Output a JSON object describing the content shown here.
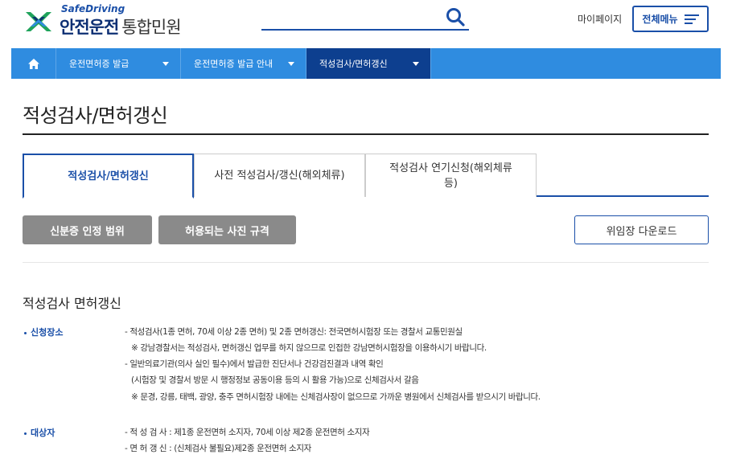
{
  "header": {
    "logo_en": "SafeDriving",
    "logo_ko": "안전운전",
    "logo_sub": "통합민원",
    "search_placeholder": "",
    "mypage": "마이페이지",
    "allmenu": "전체메뉴"
  },
  "nav": {
    "items": [
      {
        "label": "운전면허증 발급"
      },
      {
        "label": "운전면허증 발급 안내"
      },
      {
        "label": "적성검사/면허갱신"
      }
    ]
  },
  "page": {
    "title": "적성검사/면허갱신"
  },
  "tabs": [
    {
      "label": "적성검사/면허갱신"
    },
    {
      "label": "사전 적성검사/갱신(해외체류)"
    },
    {
      "label": "적성검사 연기신청(해외체류 등)"
    }
  ],
  "buttons": {
    "id_scope": "신분증 인정 범위",
    "photo_spec": "허용되는 사진 규격",
    "proxy_download": "위임장 다운로드"
  },
  "section": {
    "title": "적성검사 면허갱신",
    "place_label": "신청장소",
    "place_lines": [
      "- 적성검사(1종 면허, 70세 이상 2종 면허) 및 2종 면허갱신: 전국면허시험장 또는 경찰서 교통민원실",
      "※ 강남경찰서는 적성검사, 면허갱신 업무를 하지 않으므로 인접한 강남면허시험장을 이용하시기 바랍니다.",
      "- 일반의료기관(의사 실인 필수)에서 발급한 진단서나 건강검진결과 내역 확인",
      "(시험장 및 경찰서 방문 시 행정정보 공동이용 등의 시 활용 가능)으로 신체검사서 갈음",
      "※ 문경, 강릉, 태백, 광양, 충주 면허시험장 내에는 신체검사장이 없으므로 가까운 병원에서 신체검사를 받으시기 바랍니다."
    ],
    "target_label": "대상자",
    "target_lines": [
      "- 적 성 검 사 : 제1종 운전면허 소지자, 70세 이상 제2종 운전면허 소지자",
      "- 면 허 갱 신 : (신체검사 불필요)제2종 운전면허 소지자"
    ]
  },
  "colors": {
    "nav_blue": "#2f8ce0",
    "nav_active": "#0d3f8f",
    "brand_blue": "#1a4fa8",
    "logo_green": "#1fa35b"
  }
}
